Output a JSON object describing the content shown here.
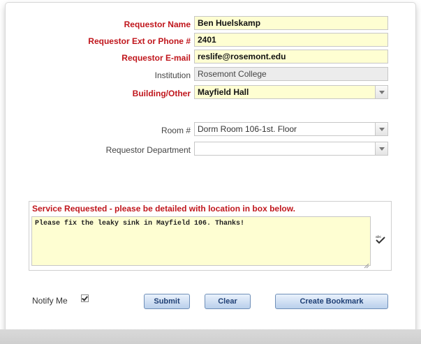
{
  "form": {
    "requestor_name": {
      "label": "Requestor Name",
      "value": "Ben Huelskamp"
    },
    "requestor_phone": {
      "label": "Requestor Ext or Phone #",
      "value": "2401"
    },
    "requestor_email": {
      "label": "Requestor E-mail",
      "value": "reslife@rosemont.edu"
    },
    "institution": {
      "label": "Institution",
      "value": "Rosemont College"
    },
    "building": {
      "label": "Building/Other",
      "value": "Mayfield Hall"
    },
    "room": {
      "label": "Room #",
      "value": "Dorm Room 106-1st. Floor"
    },
    "department": {
      "label": "Requestor Department",
      "value": ""
    }
  },
  "service": {
    "title": "Service Requested - please be detailed with location in box below.",
    "text": "Please fix the leaky sink in Mayfield 106. Thanks!"
  },
  "footer": {
    "notify_label": "Notify Me",
    "notify_checked": true,
    "submit_label": "Submit",
    "clear_label": "Clear",
    "bookmark_label": "Create Bookmark"
  },
  "icons": {
    "spellcheck": "spellcheck-icon",
    "dropdown": "chevron-down-icon"
  },
  "colors": {
    "required_label": "#c0161c",
    "field_highlight": "#fefed2",
    "button_text": "#1e3f75"
  }
}
